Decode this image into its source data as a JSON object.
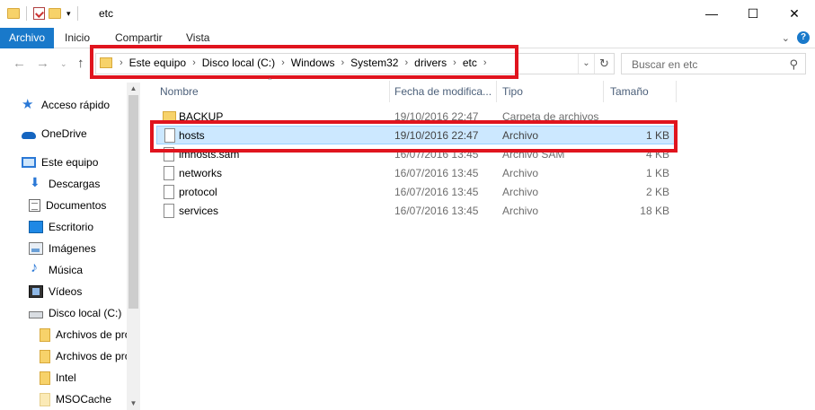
{
  "window": {
    "title": "etc"
  },
  "window_buttons": [
    "—",
    "☐",
    "✕"
  ],
  "ribbon": {
    "tabs": [
      "Archivo",
      "Inicio",
      "Compartir",
      "Vista"
    ],
    "active": "Archivo"
  },
  "address": {
    "crumbs": [
      "Este equipo",
      "Disco local (C:)",
      "Windows",
      "System32",
      "drivers",
      "etc"
    ]
  },
  "search": {
    "placeholder": "Buscar en etc"
  },
  "sidebar": {
    "items": [
      {
        "label": "Acceso rápido",
        "icon": "star-icon"
      },
      {
        "label": "OneDrive",
        "icon": "cloud-icon"
      },
      {
        "label": "Este equipo",
        "icon": "computer-icon"
      },
      {
        "label": "Descargas",
        "icon": "download-icon"
      },
      {
        "label": "Documentos",
        "icon": "document-icon"
      },
      {
        "label": "Escritorio",
        "icon": "desktop-icon"
      },
      {
        "label": "Imágenes",
        "icon": "pictures-icon"
      },
      {
        "label": "Música",
        "icon": "music-icon"
      },
      {
        "label": "Vídeos",
        "icon": "video-icon"
      },
      {
        "label": "Disco local (C:)",
        "icon": "drive-icon"
      },
      {
        "label": "Archivos de pro",
        "icon": "folder-icon"
      },
      {
        "label": "Archivos de pro",
        "icon": "folder-icon"
      },
      {
        "label": "Intel",
        "icon": "folder-icon"
      },
      {
        "label": "MSOCache",
        "icon": "folder-icon"
      }
    ]
  },
  "columns": {
    "name": "Nombre",
    "date": "Fecha de modifica...",
    "type": "Tipo",
    "size": "Tamaño"
  },
  "files": [
    {
      "name": "BACKUP",
      "date": "19/10/2016 22:47",
      "type": "Carpeta de archivos",
      "size": "",
      "kind": "folder"
    },
    {
      "name": "hosts",
      "date": "19/10/2016 22:47",
      "type": "Archivo",
      "size": "1 KB",
      "kind": "file",
      "selected": true
    },
    {
      "name": "lmhosts.sam",
      "date": "16/07/2016 13:45",
      "type": "Archivo SAM",
      "size": "4 KB",
      "kind": "file"
    },
    {
      "name": "networks",
      "date": "16/07/2016 13:45",
      "type": "Archivo",
      "size": "1 KB",
      "kind": "file"
    },
    {
      "name": "protocol",
      "date": "16/07/2016 13:45",
      "type": "Archivo",
      "size": "2 KB",
      "kind": "file"
    },
    {
      "name": "services",
      "date": "16/07/2016 13:45",
      "type": "Archivo",
      "size": "18 KB",
      "kind": "file"
    }
  ],
  "colors": {
    "accent": "#1979ca",
    "selection": "#cce8ff",
    "highlight_box": "#e0141e"
  }
}
